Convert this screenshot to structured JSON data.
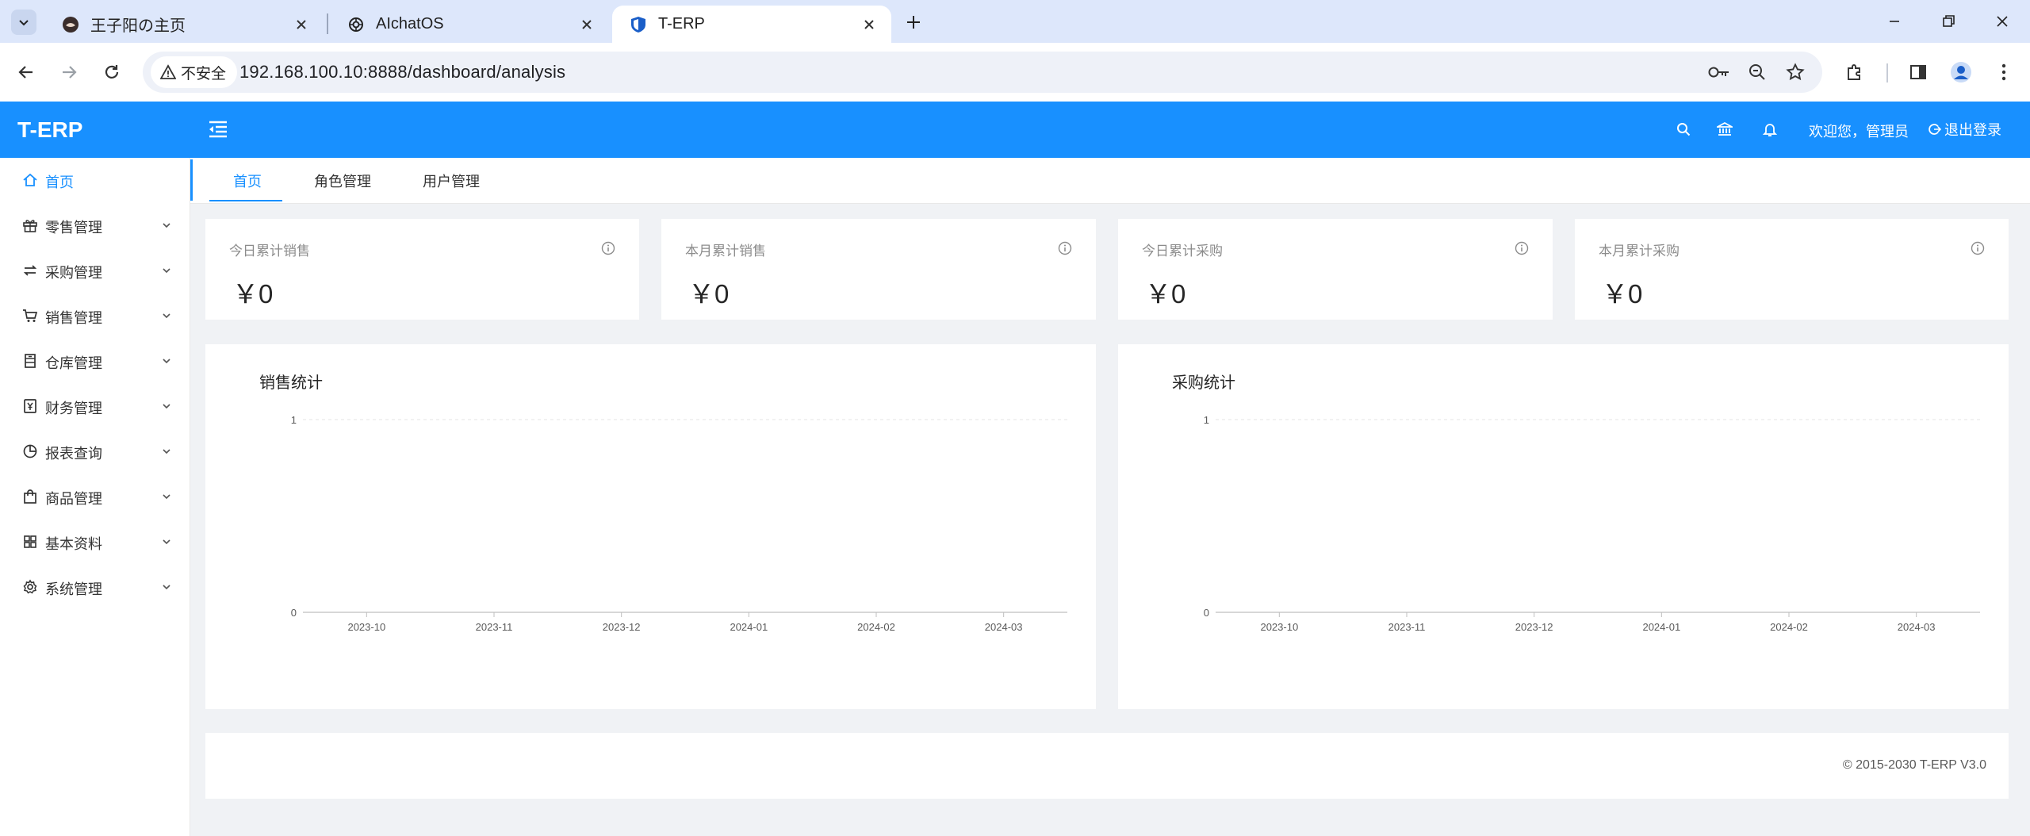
{
  "browser": {
    "tabs": [
      {
        "title": "王子阳の主页",
        "active": false
      },
      {
        "title": "AIchatOS",
        "active": false
      },
      {
        "title": "T-ERP",
        "active": true
      }
    ],
    "security_label": "不安全",
    "url": "192.168.100.10:8888/dashboard/analysis"
  },
  "header": {
    "logo": "T-ERP",
    "welcome": "欢迎您，管理员",
    "logout": "退出登录",
    "accent_color": "#1890ff"
  },
  "sidebar": {
    "items": [
      {
        "label": "首页",
        "icon": "home-icon",
        "active": true,
        "expandable": false
      },
      {
        "label": "零售管理",
        "icon": "gift-icon",
        "active": false,
        "expandable": true
      },
      {
        "label": "采购管理",
        "icon": "swap-icon",
        "active": false,
        "expandable": true
      },
      {
        "label": "销售管理",
        "icon": "cart-icon",
        "active": false,
        "expandable": true
      },
      {
        "label": "仓库管理",
        "icon": "warehouse-icon",
        "active": false,
        "expandable": true
      },
      {
        "label": "财务管理",
        "icon": "money-icon",
        "active": false,
        "expandable": true
      },
      {
        "label": "报表查询",
        "icon": "pie-chart-icon",
        "active": false,
        "expandable": true
      },
      {
        "label": "商品管理",
        "icon": "bag-icon",
        "active": false,
        "expandable": true
      },
      {
        "label": "基本资料",
        "icon": "grid-icon",
        "active": false,
        "expandable": true
      },
      {
        "label": "系统管理",
        "icon": "gear-icon",
        "active": false,
        "expandable": true
      }
    ]
  },
  "page_tabs": [
    {
      "label": "首页",
      "active": true
    },
    {
      "label": "角色管理",
      "active": false
    },
    {
      "label": "用户管理",
      "active": false
    }
  ],
  "stats": [
    {
      "label": "今日累计销售",
      "value": "￥0"
    },
    {
      "label": "本月累计销售",
      "value": "￥0"
    },
    {
      "label": "今日累计采购",
      "value": "￥0"
    },
    {
      "label": "本月累计采购",
      "value": "￥0"
    }
  ],
  "chart_data": [
    {
      "type": "bar",
      "title": "销售统计",
      "categories": [
        "2023-10",
        "2023-11",
        "2023-12",
        "2024-01",
        "2024-02",
        "2024-03"
      ],
      "values": [
        0,
        0,
        0,
        0,
        0,
        0
      ],
      "ylim": [
        0,
        1
      ],
      "yticks": [
        "0",
        "1"
      ],
      "grid": true
    },
    {
      "type": "bar",
      "title": "采购统计",
      "categories": [
        "2023-10",
        "2023-11",
        "2023-12",
        "2024-01",
        "2024-02",
        "2024-03"
      ],
      "values": [
        0,
        0,
        0,
        0,
        0,
        0
      ],
      "ylim": [
        0,
        1
      ],
      "yticks": [
        "0",
        "1"
      ],
      "grid": true
    }
  ],
  "footer": {
    "copyright": "© 2015-2030 T-ERP V3.0"
  }
}
